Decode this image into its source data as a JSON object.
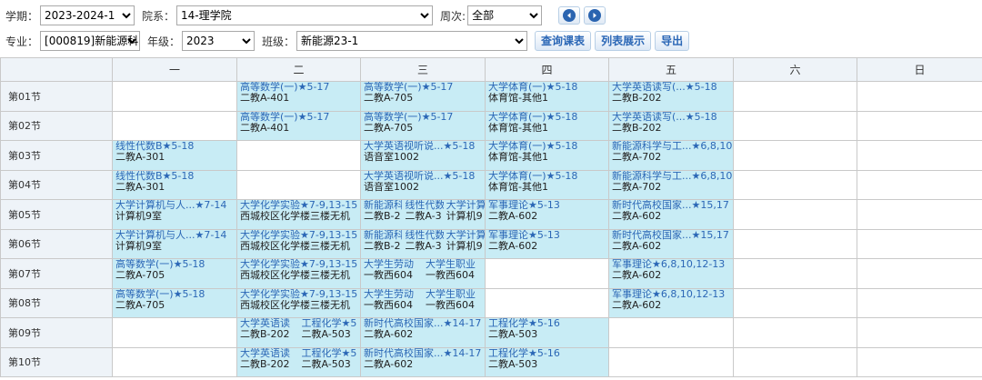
{
  "filters": {
    "term_label": "学期：",
    "term_value": "2023-2024-1",
    "dept_label": "院系：",
    "dept_value": "14-理学院",
    "week_label": "周次:",
    "week_value": "全部",
    "major_label": "专业：",
    "major_value": "[000819]新能源科",
    "grade_label": "年级：",
    "grade_value": "2023",
    "class_label": "班级：",
    "class_value": "新能源23-1"
  },
  "buttons": {
    "query": "查询课表",
    "list": "列表展示",
    "export": "导出"
  },
  "timetable": {
    "days": [
      "一",
      "二",
      "三",
      "四",
      "五",
      "六",
      "日"
    ],
    "periods": [
      {
        "label": "第01节",
        "cells": [
          [],
          [
            {
              "name": "高等数学(一)★5-17",
              "room": "二教A-401"
            }
          ],
          [
            {
              "name": "高等数学(一)★5-17",
              "room": "二教A-705"
            }
          ],
          [
            {
              "name": "大学体育(一)★5-18",
              "room": "体育馆-其他1"
            }
          ],
          [
            {
              "name": "大学英语读写(...★5-18",
              "room": "二教B-202"
            }
          ],
          [],
          []
        ]
      },
      {
        "label": "第02节",
        "cells": [
          [],
          [
            {
              "name": "高等数学(一)★5-17",
              "room": "二教A-401"
            }
          ],
          [
            {
              "name": "高等数学(一)★5-17",
              "room": "二教A-705"
            }
          ],
          [
            {
              "name": "大学体育(一)★5-18",
              "room": "体育馆-其他1"
            }
          ],
          [
            {
              "name": "大学英语读写(...★5-18",
              "room": "二教B-202"
            }
          ],
          [],
          []
        ]
      },
      {
        "label": "第03节",
        "cells": [
          [
            {
              "name": "线性代数B★5-18",
              "room": "二教A-301"
            }
          ],
          [],
          [
            {
              "name": "大学英语视听说...★5-18",
              "room": "语音室1002"
            }
          ],
          [
            {
              "name": "大学体育(一)★5-18",
              "room": "体育馆-其他1"
            }
          ],
          [
            {
              "name": "新能源科学与工...★6,8,10",
              "room": "二教A-702"
            }
          ],
          [],
          []
        ]
      },
      {
        "label": "第04节",
        "cells": [
          [
            {
              "name": "线性代数B★5-18",
              "room": "二教A-301"
            }
          ],
          [],
          [
            {
              "name": "大学英语视听说...★5-18",
              "room": "语音室1002"
            }
          ],
          [
            {
              "name": "大学体育(一)★5-18",
              "room": "体育馆-其他1"
            }
          ],
          [
            {
              "name": "新能源科学与工...★6,8,10",
              "room": "二教A-702"
            }
          ],
          [],
          []
        ]
      },
      {
        "label": "第05节",
        "cells": [
          [
            {
              "name": "大学计算机与人...★7-14",
              "room": "计算机9室"
            }
          ],
          [
            {
              "name": "大学化学实验★7-9,13-15",
              "room": "西城校区化学楼三楼无机"
            }
          ],
          [
            {
              "name": "新能源科",
              "room": "二教B-2"
            },
            {
              "name": "线性代数",
              "room": "二教A-3"
            },
            {
              "name": "大学计算",
              "room": "计算机9"
            }
          ],
          [
            {
              "name": "军事理论★5-13",
              "room": "二教A-602"
            }
          ],
          [
            {
              "name": "新时代高校国家...★15,17",
              "room": "二教A-602"
            }
          ],
          [],
          []
        ]
      },
      {
        "label": "第06节",
        "cells": [
          [
            {
              "name": "大学计算机与人...★7-14",
              "room": "计算机9室"
            }
          ],
          [
            {
              "name": "大学化学实验★7-9,13-15",
              "room": "西城校区化学楼三楼无机"
            }
          ],
          [
            {
              "name": "新能源科",
              "room": "二教B-2"
            },
            {
              "name": "线性代数",
              "room": "二教A-3"
            },
            {
              "name": "大学计算",
              "room": "计算机9"
            }
          ],
          [
            {
              "name": "军事理论★5-13",
              "room": "二教A-602"
            }
          ],
          [
            {
              "name": "新时代高校国家...★15,17",
              "room": "二教A-602"
            }
          ],
          [],
          []
        ]
      },
      {
        "label": "第07节",
        "cells": [
          [
            {
              "name": "高等数学(一)★5-18",
              "room": "二教A-705"
            }
          ],
          [
            {
              "name": "大学化学实验★7-9,13-15",
              "room": "西城校区化学楼三楼无机"
            }
          ],
          [
            {
              "name": "大学生劳动",
              "room": "一教西604"
            },
            {
              "name": "大学生职业",
              "room": "一教西604"
            }
          ],
          [],
          [
            {
              "name": "军事理论★6,8,10,12-13",
              "room": "二教A-602"
            }
          ],
          [],
          []
        ]
      },
      {
        "label": "第08节",
        "cells": [
          [
            {
              "name": "高等数学(一)★5-18",
              "room": "二教A-705"
            }
          ],
          [
            {
              "name": "大学化学实验★7-9,13-15",
              "room": "西城校区化学楼三楼无机"
            }
          ],
          [
            {
              "name": "大学生劳动",
              "room": "一教西604"
            },
            {
              "name": "大学生职业",
              "room": "一教西604"
            }
          ],
          [],
          [
            {
              "name": "军事理论★6,8,10,12-13",
              "room": "二教A-602"
            }
          ],
          [],
          []
        ]
      },
      {
        "label": "第09节",
        "cells": [
          [],
          [
            {
              "name": "大学英语读",
              "room": "二教B-202"
            },
            {
              "name": "工程化学★5",
              "room": "二教A-503"
            }
          ],
          [
            {
              "name": "新时代高校国家...★14-17",
              "room": "二教A-602"
            }
          ],
          [
            {
              "name": "工程化学★5-16",
              "room": "二教A-503"
            }
          ],
          [],
          [],
          []
        ]
      },
      {
        "label": "第10节",
        "cells": [
          [],
          [
            {
              "name": "大学英语读",
              "room": "二教B-202"
            },
            {
              "name": "工程化学★5",
              "room": "二教A-503"
            }
          ],
          [
            {
              "name": "新时代高校国家...★14-17",
              "room": "二教A-602"
            }
          ],
          [
            {
              "name": "工程化学★5-16",
              "room": "二教A-503"
            }
          ],
          [],
          [],
          []
        ]
      }
    ]
  }
}
